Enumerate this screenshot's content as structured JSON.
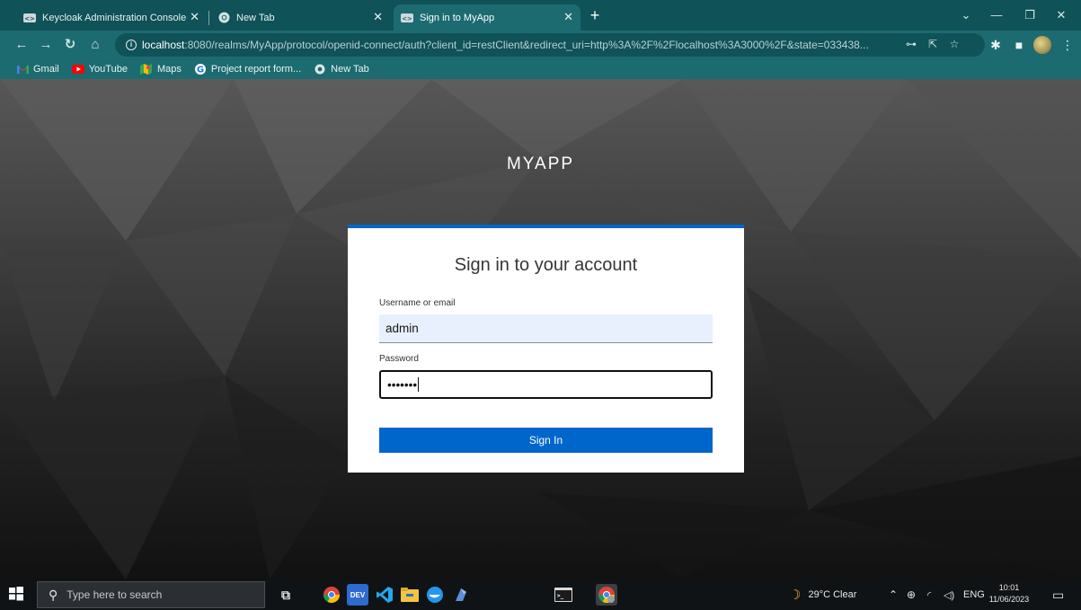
{
  "browser": {
    "tabs": [
      {
        "title": "Keycloak Administration Console",
        "icon": "keycloak-icon"
      },
      {
        "title": "New Tab",
        "icon": "chrome-icon"
      },
      {
        "title": "Sign in to MyApp",
        "icon": "keycloak-icon",
        "active": true
      }
    ],
    "url_host": "localhost",
    "url_rest": ":8080/realms/MyApp/protocol/openid-connect/auth?client_id=restClient&redirect_uri=http%3A%2F%2Flocalhost%3A3000%2F&state=033438...",
    "bookmarks": [
      {
        "label": "Gmail",
        "icon": "gmail-icon"
      },
      {
        "label": "YouTube",
        "icon": "youtube-icon"
      },
      {
        "label": "Maps",
        "icon": "maps-icon"
      },
      {
        "label": "Project report form...",
        "icon": "google-icon"
      },
      {
        "label": "New Tab",
        "icon": "chrome-icon"
      }
    ]
  },
  "page": {
    "brand": "MYAPP",
    "card_title": "Sign in to your account",
    "username_label": "Username or email",
    "username_value": "admin",
    "password_label": "Password",
    "password_value": "•••••••",
    "submit_label": "Sign In",
    "accent_color": "#0066cc"
  },
  "taskbar": {
    "search_placeholder": "Type here to search",
    "weather": "29°C  Clear",
    "language": "ENG",
    "time": "10:01",
    "date": "11/06/2023"
  }
}
